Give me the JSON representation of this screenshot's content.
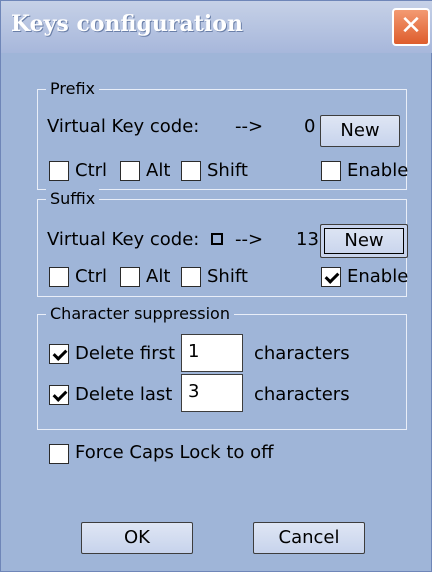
{
  "window": {
    "title": "Keys configuration",
    "close_label": "✕"
  },
  "prefix": {
    "legend": "Prefix",
    "vk_label": "Virtual Key code:",
    "arrow": "-->",
    "code": "0",
    "new_button": "New",
    "ctrl": "Ctrl",
    "alt": "Alt",
    "shift": "Shift",
    "enable": "Enable"
  },
  "suffix": {
    "legend": "Suffix",
    "vk_label": "Virtual Key code:",
    "arrow": "-->",
    "code": "13",
    "new_button": "New",
    "ctrl": "Ctrl",
    "alt": "Alt",
    "shift": "Shift",
    "enable": "Enable"
  },
  "suppression": {
    "legend": "Character suppression",
    "delete_first_label": "Delete first",
    "delete_first_value": "1",
    "delete_last_label": "Delete last",
    "delete_last_value": "3",
    "characters": "characters"
  },
  "force_caps_label": "Force Caps Lock to off",
  "buttons": {
    "ok": "OK",
    "cancel": "Cancel"
  }
}
